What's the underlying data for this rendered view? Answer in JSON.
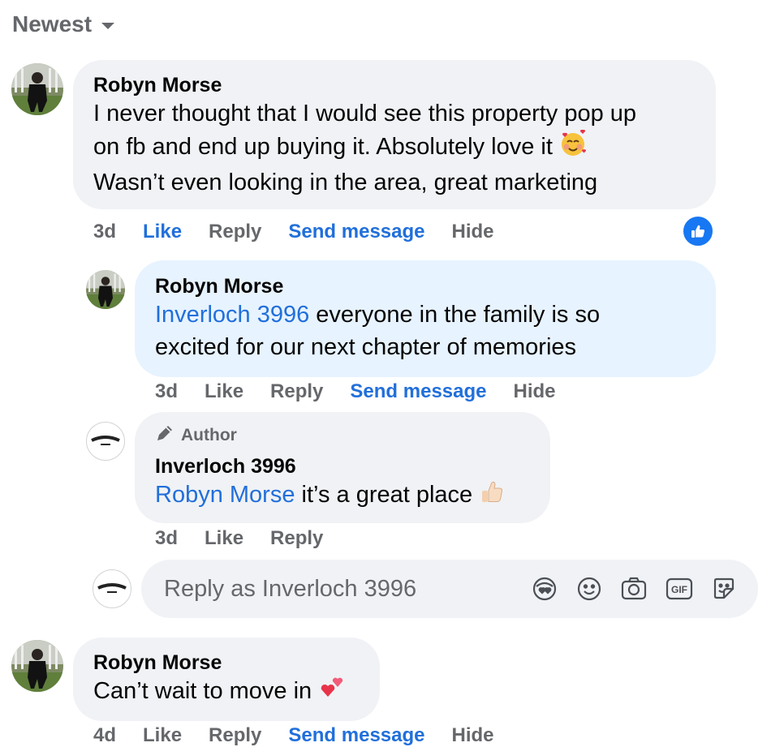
{
  "sort": {
    "label": "Newest"
  },
  "comments": [
    {
      "author": "Robyn Morse",
      "lines": [
        "I never thought that I would see this property pop up",
        "on fb and end up buying it. Absolutely love it",
        "Wasn’t even looking in the area, great marketing"
      ],
      "time": "3d",
      "actions": {
        "like": "Like",
        "reply": "Reply",
        "send": "Send message",
        "hide": "Hide"
      },
      "reaction": "like-icon"
    },
    {
      "author": "Robyn Morse",
      "mention": "Inverloch 3996",
      "line1_rest": " everyone in the family is so",
      "line2": "excited for our next chapter of memories",
      "time": "3d",
      "actions": {
        "like": "Like",
        "reply": "Reply",
        "send": "Send message",
        "hide": "Hide"
      }
    },
    {
      "badge": "Author",
      "author": "Inverloch 3996",
      "mention": "Robyn Morse",
      "rest": " it’s a great place",
      "time": "3d",
      "actions": {
        "like": "Like",
        "reply": "Reply"
      }
    },
    {
      "author": "Robyn Morse",
      "text": "Can’t wait to move in",
      "time": "4d",
      "actions": {
        "like": "Like",
        "reply": "Reply",
        "send": "Send message",
        "hide": "Hide"
      }
    }
  ],
  "reply_input": {
    "placeholder": "Reply as Inverloch 3996"
  },
  "tools": [
    "avatar-sticker-icon",
    "emoji-icon",
    "camera-icon",
    "gif-icon",
    "sticker-icon"
  ],
  "colors": {
    "link": "#216fdb",
    "muted": "#65676b",
    "bubble": "#f0f2f5",
    "highlight": "#e7f3ff",
    "like": "#1877f2"
  }
}
